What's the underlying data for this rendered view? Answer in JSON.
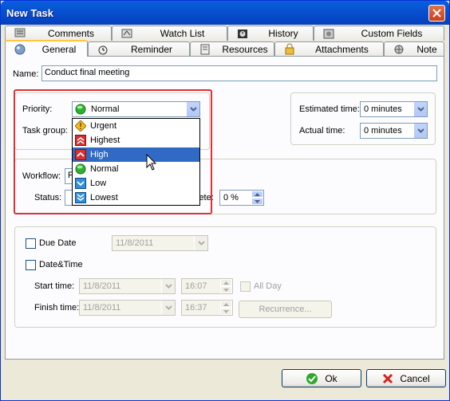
{
  "window": {
    "title": "New Task"
  },
  "tabs_row1": [
    {
      "label": "Comments",
      "icon": "comments-icon"
    },
    {
      "label": "Watch List",
      "icon": "watch-list-icon"
    },
    {
      "label": "History",
      "icon": "history-icon"
    },
    {
      "label": "Custom Fields",
      "icon": "custom-fields-icon"
    }
  ],
  "tabs_row2": [
    {
      "label": "General",
      "icon": "general-icon",
      "active": true
    },
    {
      "label": "Reminder",
      "icon": "reminder-icon"
    },
    {
      "label": "Resources",
      "icon": "resources-icon"
    },
    {
      "label": "Attachments",
      "icon": "attachments-icon"
    },
    {
      "label": "Note",
      "icon": "note-icon"
    }
  ],
  "form": {
    "name_label": "Name:",
    "name_value": "Conduct final meeting",
    "priority_label": "Priority:",
    "priority_value": "Normal",
    "task_group_label": "Task group:",
    "workflow_label": "Workflow:",
    "workflow_value": "F",
    "status_label": "Status:",
    "complete_label": "lete:",
    "complete_value": "0 %",
    "estimated_time_label": "Estimated time:",
    "estimated_time_value": "0 minutes",
    "actual_time_label": "Actual time:",
    "actual_time_value": "0 minutes"
  },
  "priority_dropdown": {
    "options": [
      {
        "label": "Urgent",
        "icon": "urgent-icon",
        "color": "#f0c020"
      },
      {
        "label": "Highest",
        "icon": "highest-icon",
        "color": "#d83030"
      },
      {
        "label": "High",
        "icon": "high-icon",
        "color": "#d83030",
        "selected": true
      },
      {
        "label": "Normal",
        "icon": "normal-icon",
        "color": "#30b030"
      },
      {
        "label": "Low",
        "icon": "low-icon",
        "color": "#3090e0"
      },
      {
        "label": "Lowest",
        "icon": "lowest-icon",
        "color": "#3090e0"
      }
    ]
  },
  "dates": {
    "due_date_label": "Due Date",
    "due_date_value": "11/8/2011",
    "datetime_label": "Date&Time",
    "start_time_label": "Start time:",
    "start_date_value": "11/8/2011",
    "start_time_value": "16:07",
    "all_day_label": "All Day",
    "finish_time_label": "Finish time:",
    "finish_date_value": "11/8/2011",
    "finish_time_value": "16:37",
    "recurrence_label": "Recurrence..."
  },
  "buttons": {
    "ok_label": "Ok",
    "cancel_label": "Cancel"
  },
  "colors": {
    "title_bar": "#0752d1",
    "highlight": "#e03030",
    "selection": "#316ac5"
  }
}
